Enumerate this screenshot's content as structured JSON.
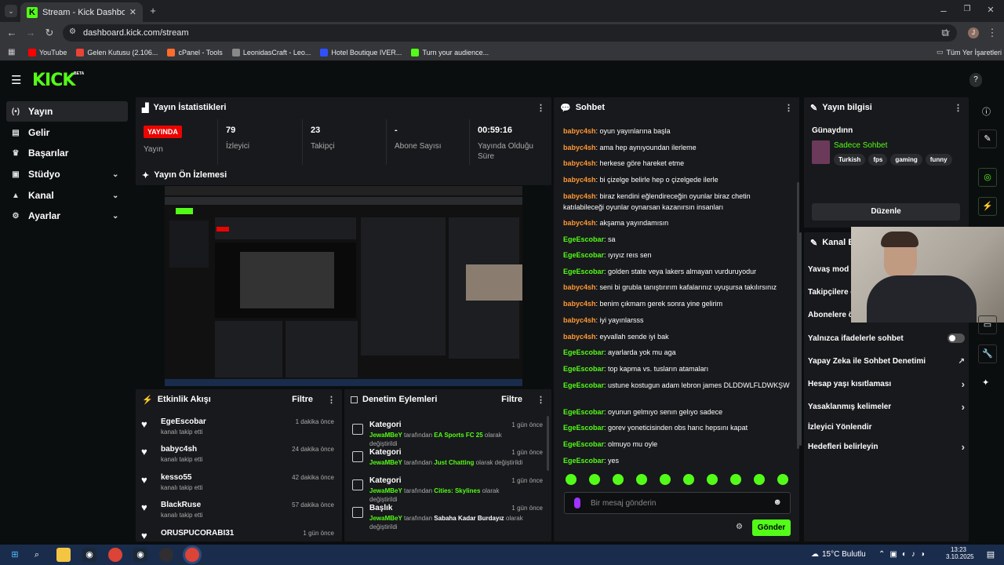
{
  "browser": {
    "tab_title": "Stream - Kick Dashboard",
    "url": "dashboard.kick.com/stream",
    "bookmarks": [
      {
        "label": "YouTube",
        "color": "#ff0000"
      },
      {
        "label": "Gelen Kutusu (2.106...",
        "color": "#ea4335"
      },
      {
        "label": "cPanel - Tools",
        "color": "#ff6c2c"
      },
      {
        "label": "LeonidasCraft - Leo...",
        "color": "#888888"
      },
      {
        "label": "Hotel Boutique IVER...",
        "color": "#3050ff"
      },
      {
        "label": "Turn your audience...",
        "color": "#53fc18"
      }
    ],
    "all_bookmarks": "Tüm Yer İşaretleri",
    "profile_initial": "J"
  },
  "kick": {
    "logo": "KICK",
    "logo_badge": "BETA",
    "accent": "#53fc18"
  },
  "sidebar": {
    "items": [
      {
        "label": "Yayın",
        "icon": "broadcast-icon",
        "glyph": "(•)",
        "active": true,
        "chevron": false
      },
      {
        "label": "Gelir",
        "icon": "revenue-icon",
        "glyph": "▤",
        "active": false,
        "chevron": false
      },
      {
        "label": "Başarılar",
        "icon": "trophy-icon",
        "glyph": "♛",
        "active": false,
        "chevron": false
      },
      {
        "label": "Stüdyo",
        "icon": "studio-icon",
        "glyph": "▣",
        "active": false,
        "chevron": true
      },
      {
        "label": "Kanal",
        "icon": "channel-icon",
        "glyph": "▲",
        "active": false,
        "chevron": true
      },
      {
        "label": "Ayarlar",
        "icon": "settings-icon",
        "glyph": "⚙",
        "active": false,
        "chevron": true
      }
    ]
  },
  "stats": {
    "title": "Yayın İstatistikleri",
    "live_badge": "YAYINDA",
    "live_label": "Yayın",
    "items": [
      {
        "value": "79",
        "label": "İzleyici"
      },
      {
        "value": "23",
        "label": "Takipçi"
      },
      {
        "value": "-",
        "label": "Abone Sayısı"
      },
      {
        "value": "00:59:16",
        "label": "Yayında Olduğu Süre"
      }
    ]
  },
  "preview": {
    "title": "Yayın Ön İzlemesi"
  },
  "activity": {
    "title": "Etkinlik Akışı",
    "filter": "Filtre",
    "items": [
      {
        "name": "EgeEscobar",
        "sub": "kanalı takip etti",
        "time": "1 dakika önce"
      },
      {
        "name": "babyc4sh",
        "sub": "kanalı takip etti",
        "time": "24 dakika önce"
      },
      {
        "name": "kesso55",
        "sub": "kanalı takip etti",
        "time": "42 dakika önce"
      },
      {
        "name": "BlackRuse",
        "sub": "kanalı takip etti",
        "time": "57 dakika önce"
      },
      {
        "name": "ORUSPUCORABI31",
        "sub": "",
        "time": "1 gün önce"
      }
    ]
  },
  "moderation": {
    "title": "Denetim Eylemleri",
    "filter": "Filtre",
    "items": [
      {
        "name": "Kategori",
        "user": "JewaMBeY",
        "mid": "tarafından",
        "value": "EA Sports FC 25",
        "end": "olarak değiştirildi",
        "time": "1 gün önce"
      },
      {
        "name": "Kategori",
        "user": "JewaMBeY",
        "mid": "tarafından",
        "value": "Just Chatting",
        "end": "olarak değiştirildi",
        "time": "1 gün önce"
      },
      {
        "name": "Kategori",
        "user": "JewaMBeY",
        "mid": "tarafından",
        "value": "Cities: Skylines",
        "end": "olarak değiştirildi",
        "time": "1 gün önce"
      },
      {
        "name": "Başlık",
        "user": "JewaMBeY",
        "mid": "tarafından",
        "value": "Sabaha Kadar Burdayız",
        "end": "olarak değiştirildi",
        "time": "1 gün önce"
      }
    ]
  },
  "chat": {
    "title": "Sohbet",
    "placeholder": "Bir mesaj gönderin",
    "send": "Gönder",
    "messages": [
      {
        "user": "babyc4sh",
        "color": "#ff9933",
        "text": "oyun yayınlarına başla"
      },
      {
        "user": "babyc4sh",
        "color": "#ff9933",
        "text": "ama hep aynıyoundan ilerleme"
      },
      {
        "user": "babyc4sh",
        "color": "#ff9933",
        "text": "herkese göre hareket etme"
      },
      {
        "user": "babyc4sh",
        "color": "#ff9933",
        "text": "bi çizelge belirle hep o çizelgede ilerle"
      },
      {
        "user": "babyc4sh",
        "color": "#ff9933",
        "text": "biraz kendini eğlendireceğin oyunlar biraz chetin katılabileceği oyunlar oynarsan kazanırsın insanları"
      },
      {
        "user": "babyc4sh",
        "color": "#ff9933",
        "text": "akşama yayındamısın"
      },
      {
        "user": "EgeEscobar",
        "color": "#53fc18",
        "text": "sa"
      },
      {
        "user": "EgeEscobar",
        "color": "#53fc18",
        "text": "ıyıyız reıs sen"
      },
      {
        "user": "EgeEscobar",
        "color": "#53fc18",
        "text": "golden state veya lakers almayan vurduruyodur"
      },
      {
        "user": "babyc4sh",
        "color": "#ff9933",
        "text": "seni bi grubla tanıştırırım kafalarınız uyuşursa takılırsınız"
      },
      {
        "user": "babyc4sh",
        "color": "#ff9933",
        "text": "benim çıkmam gerek sonra yine gelirim"
      },
      {
        "user": "babyc4sh",
        "color": "#ff9933",
        "text": "iyi yayınlarsss"
      },
      {
        "user": "babyc4sh",
        "color": "#ff9933",
        "text": "eyvallah sende iyi bak"
      },
      {
        "user": "EgeEscobar",
        "color": "#53fc18",
        "text": "ayarlarda yok mu aga"
      },
      {
        "user": "EgeEscobar",
        "color": "#53fc18",
        "text": "top kapma vs. tusların atamaları"
      },
      {
        "user": "EgeEscobar",
        "color": "#53fc18",
        "text": "ustune kostugun adam lebron james DLDDWLFLDWKŞW"
      },
      {
        "user": "EgeEscobar",
        "color": "#53fc18",
        "text": "oyunun gelmıyo senın gelıyo sadece"
      },
      {
        "user": "EgeEscobar",
        "color": "#53fc18",
        "text": "gorev yoneticisinden obs harıc hepsını kapat"
      },
      {
        "user": "EgeEscobar",
        "color": "#53fc18",
        "text": "olmuyo mu oyle"
      },
      {
        "user": "EgeEscobar",
        "color": "#53fc18",
        "text": "yes"
      }
    ]
  },
  "stream_info": {
    "title": "Yayın bilgisi",
    "stream_title": "Günaydınn",
    "category": "Sadece Sohbet",
    "tags": [
      "Turkish",
      "fps",
      "gaming",
      "funny"
    ],
    "edit": "Düzenle"
  },
  "channel_actions": {
    "title": "Kanal Eylemleri",
    "title_visible": "Kanal Ey",
    "rows": [
      {
        "label": "Yavaş mod",
        "kind": "none"
      },
      {
        "label": "Takipçilere ö",
        "kind": "none"
      },
      {
        "label": "Abonelere ö",
        "kind": "none"
      },
      {
        "label": "Yalnızca ifadelerle sohbet",
        "kind": "toggle"
      },
      {
        "label": "Yapay Zeka ile Sohbet Denetimi",
        "kind": "ext"
      },
      {
        "label": "Hesap yaşı kısıtlaması",
        "kind": "chevron"
      },
      {
        "label": "Yasaklanmış kelimeler",
        "kind": "chevron"
      },
      {
        "label": "İzleyici Yönlendir",
        "kind": "none"
      },
      {
        "label": "Hedefleri belirleyin",
        "kind": "chevron"
      }
    ]
  },
  "taskbar": {
    "weather": "15°C Bulutlu",
    "time": "13:23",
    "date": "3.10.2025"
  }
}
